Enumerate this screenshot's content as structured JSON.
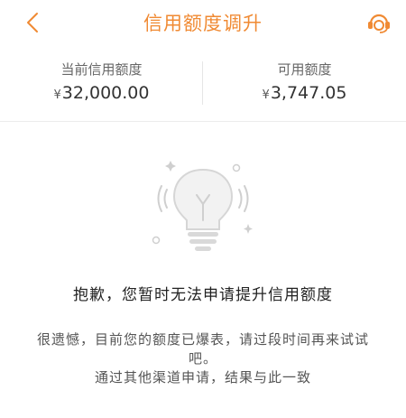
{
  "header": {
    "title": "信用额度调升",
    "back_icon": "chevron-left-icon",
    "service_icon": "customer-service-headset-icon"
  },
  "quota": {
    "current_label": "当前信用额度",
    "current_currency": "¥",
    "current_value": "32,000.00",
    "available_label": "可用额度",
    "available_currency": "¥",
    "available_value": "3,747.05"
  },
  "message": {
    "title": "抱歉，您暂时无法申请提升信用额度",
    "body_line1": "很遗憾，目前您的额度已爆表，请过段时间再来试试",
    "body_line2": "吧。",
    "body_line3": "通过其他渠道申请，结果与此一致"
  },
  "colors": {
    "accent": "#f08a33",
    "divider": "#ececec"
  }
}
